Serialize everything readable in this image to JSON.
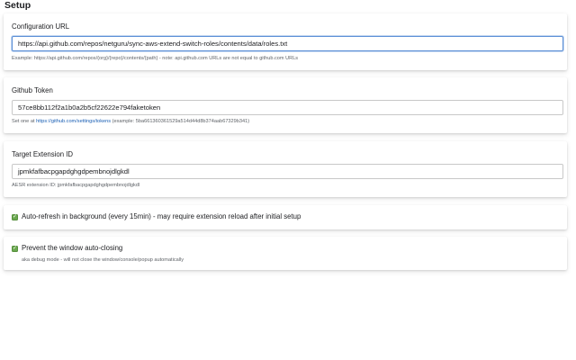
{
  "page": {
    "title": "Setup"
  },
  "config_url": {
    "label": "Configuration URL",
    "value": "https://api.github.com/repos/netguru/sync-aws-extend-switch-roles/contents/data/roles.txt",
    "help": "Example: https://api.github.com/repos/{org}/{repo}/contents/{path} - note: api.github.com URLs are not equal to github.com URLs"
  },
  "github_token": {
    "label": "Github Token",
    "value": "57ce8bb112f2a1b0a2b5cf22622e794faketoken",
    "help_prefix": "Set one at ",
    "help_link": "https://github.com/settings/tokens",
    "help_suffix": " (example: 5ba661360361529a514d44d8b374aab67329b341)"
  },
  "target_extension": {
    "label": "Target Extension ID",
    "value": "jpmkfafbacpgapdghgdpembnojdlgkdl",
    "help": "AESR extension ID: jpmkfafbacpgapdghgdpembnojdlgkdl"
  },
  "auto_refresh": {
    "checked": true,
    "label": "Auto-refresh in background (every 15min) - may require extension reload after initial setup"
  },
  "prevent_close": {
    "checked": true,
    "label": "Prevent the window auto-closing",
    "help": "aka debug mode - will not close the window/console/popup automatically"
  },
  "colors": {
    "checkbox": "#6aa84f",
    "link": "#1a5fb4",
    "focus_border": "#5b8fd6"
  }
}
